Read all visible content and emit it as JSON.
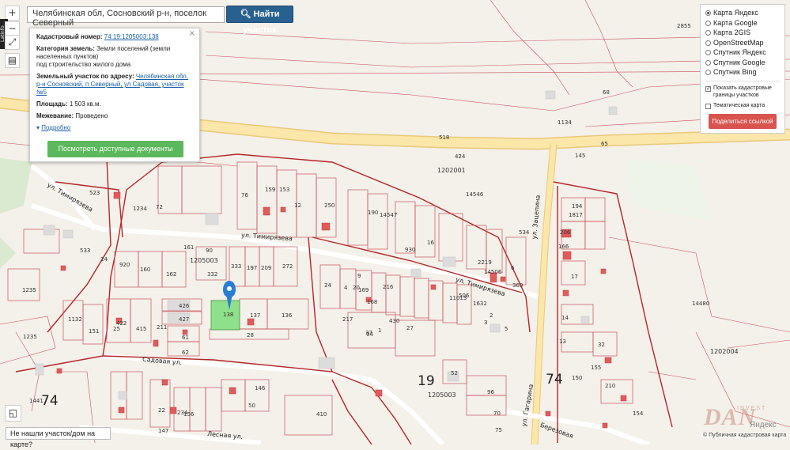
{
  "search": {
    "value": "Челябинская обл, Сосновский р-н, поселок Северный",
    "button": "Найти участок"
  },
  "controls": {
    "zoom_in": "+",
    "zoom_out": "−",
    "latinfo": "Latinfo"
  },
  "card": {
    "cad_label": "Кадастровый номер:",
    "cad_value": "74:19:1205003:138",
    "cat_label": "Категория земель:",
    "cat_value": "Земли поселений (земли населенных пунктов)",
    "cat_use": "под строительство жилого дома",
    "addr_label": "Земельный участок по адресу:",
    "addr_value": "Челябинская обл, р-н Сосновский, п Северный, ул Садовая, участок №5",
    "area_label": "Площадь:",
    "area_value": "1 503 кв.м.",
    "survey_label": "Межевание:",
    "survey_value": "Проведено",
    "more": "Подробно",
    "docs_button": "Посмотреть доступные документы",
    "close": "×"
  },
  "panel": {
    "options": [
      "Карта Яндекс",
      "Карта Google",
      "Карта 2GIS",
      "OpenStreetMap",
      "Спутник Яндекс",
      "Спутник Google",
      "Спутник Bing"
    ],
    "selected": "Карта Яндекс",
    "show_borders": "Показать кадастровые границы участков",
    "thematic": "Тематическая карта",
    "share": "Поделиться ссылкой"
  },
  "map": {
    "streets": {
      "timiryazeva1": "ул. Тимирязева",
      "timiryazeva2": "ул. Тимирязева",
      "timiryazeva3": "ул. Тимирязева",
      "sadovaya": "Садовая ул.",
      "lesnaya": "Лесная ул.",
      "zatsepina": "ул. Зацепина",
      "gagarina": "ул. Гагарина",
      "berezovaya": "Березовая"
    },
    "blocks": [
      "1205003",
      "1202001",
      "1205003",
      "1202004"
    ],
    "zones": [
      "74",
      "74",
      "19"
    ],
    "plots": [
      "523",
      "72",
      "1234",
      "76",
      "159",
      "153",
      "12",
      "250",
      "190",
      "14547",
      "14546",
      "534",
      "533",
      "24",
      "920",
      "160",
      "162",
      "161",
      "90",
      "332",
      "333",
      "197",
      "209",
      "272",
      "24",
      "4",
      "169",
      "216",
      "9",
      "168",
      "430",
      "1",
      "930",
      "16",
      "2219",
      "14506",
      "6",
      "369",
      "426",
      "427",
      "25",
      "415",
      "211",
      "137",
      "136",
      "28",
      "61",
      "62",
      "151",
      "422",
      "1132",
      "20",
      "217",
      "27",
      "37",
      "50",
      "52",
      "96",
      "94",
      "70",
      "75",
      "410",
      "146",
      "234",
      "22",
      "156",
      "147",
      "145",
      "194",
      "1817",
      "206",
      "166",
      "17",
      "14",
      "13",
      "32",
      "150",
      "210",
      "155",
      "154",
      "68",
      "65",
      "14480",
      "1235",
      "1235",
      "1441",
      "518",
      "1134",
      "424",
      "2855",
      "506",
      "11013",
      "1632",
      "2",
      "3",
      "5",
      "2",
      "14",
      "6",
      "8"
    ],
    "parcel_number": "138"
  },
  "bottom": {
    "notfound": "Не нашли участок/дом на карте?",
    "attribution": "© Публичная кадастровая карта",
    "yandex": "Яндекс",
    "logo": "DAN",
    "logo_sub": "INVEST"
  },
  "colors": {
    "road": "#fbe7a9",
    "road_edge": "#e9c97a",
    "border": "#b3262a",
    "parcel_fill": "#8fe08a",
    "building": "#dcdcdc",
    "building_red": "#e25b5b",
    "primary_btn": "#286090",
    "green_btn": "#5cb85c",
    "red_btn": "#d9534f",
    "marker": "#2a7fd0"
  }
}
